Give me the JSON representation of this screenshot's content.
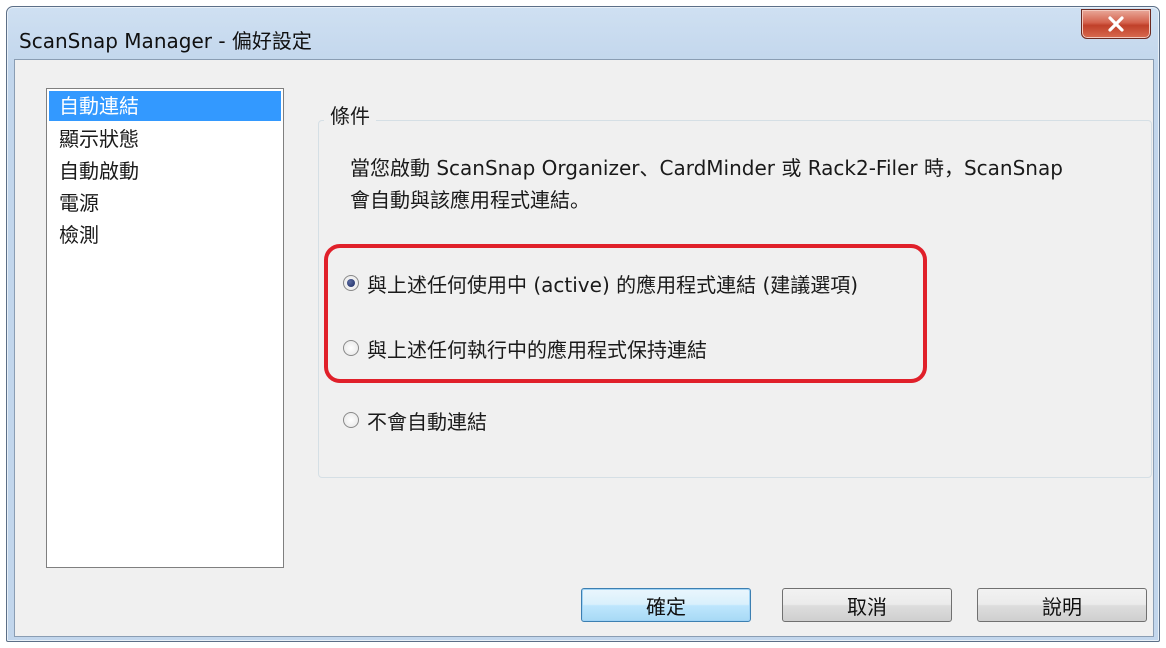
{
  "window": {
    "title": "ScanSnap Manager - 偏好設定"
  },
  "sidebar": {
    "items": [
      {
        "label": "自動連結",
        "selected": true
      },
      {
        "label": "顯示狀態",
        "selected": false
      },
      {
        "label": "自動啟動",
        "selected": false
      },
      {
        "label": "電源",
        "selected": false
      },
      {
        "label": "檢測",
        "selected": false
      }
    ]
  },
  "conditions": {
    "group_label": "條件",
    "description_line1": "當您啟動 ScanSnap Organizer、CardMinder 或 Rack2-Filer 時，ScanSnap",
    "description_line2": "會自動與該應用程式連結。",
    "options": [
      {
        "label": "與上述任何使用中 (active) 的應用程式連結 (建議選項)",
        "checked": true
      },
      {
        "label": "與上述任何執行中的應用程式保持連結",
        "checked": false
      },
      {
        "label": "不會自動連結",
        "checked": false
      }
    ]
  },
  "buttons": {
    "ok": "確定",
    "cancel": "取消",
    "help": "說明"
  },
  "colors": {
    "selection": "#3399ff",
    "highlight_frame": "#e0202a",
    "close_button": "#c0402a"
  },
  "icons": {
    "close": "close-icon"
  }
}
